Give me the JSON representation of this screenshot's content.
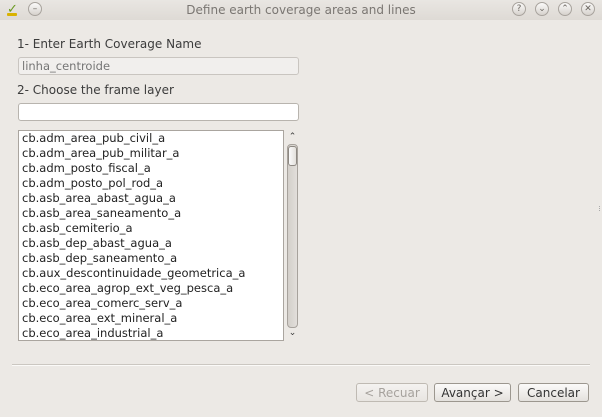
{
  "window": {
    "title": "Define earth coverage areas and lines",
    "app_icon": "qgis-check-icon",
    "controls": [
      {
        "name": "help-button",
        "glyph": "?"
      },
      {
        "name": "minimize-button",
        "glyph": "⌄"
      },
      {
        "name": "maximize-button",
        "glyph": "⌃"
      },
      {
        "name": "close-button",
        "glyph": "✕"
      }
    ],
    "menu_glyph": "–"
  },
  "step1": {
    "label": "1- Enter Earth Coverage Name",
    "placeholder": "linha_centroide",
    "value": ""
  },
  "step2": {
    "label": "2- Choose the frame layer",
    "value": ""
  },
  "layers": {
    "items": [
      "cb.adm_area_pub_civil_a",
      "cb.adm_area_pub_militar_a",
      "cb.adm_posto_fiscal_a",
      "cb.adm_posto_pol_rod_a",
      "cb.asb_area_abast_agua_a",
      "cb.asb_area_saneamento_a",
      "cb.asb_cemiterio_a",
      "cb.asb_dep_abast_agua_a",
      "cb.asb_dep_saneamento_a",
      "cb.aux_descontinuidade_geometrica_a",
      "cb.eco_area_agrop_ext_veg_pesca_a",
      "cb.eco_area_comerc_serv_a",
      "cb.eco_area_ext_mineral_a",
      "cb.eco_area_industrial_a"
    ],
    "scroll_up_glyph": "⌃",
    "scroll_down_glyph": "⌄"
  },
  "buttons": {
    "back": "< Recuar",
    "next": "Avançar >",
    "cancel": "Cancelar"
  },
  "colors": {
    "window_bg": "#ece9e5",
    "title_text": "#7a7672",
    "disabled_text": "#a6a29d"
  }
}
